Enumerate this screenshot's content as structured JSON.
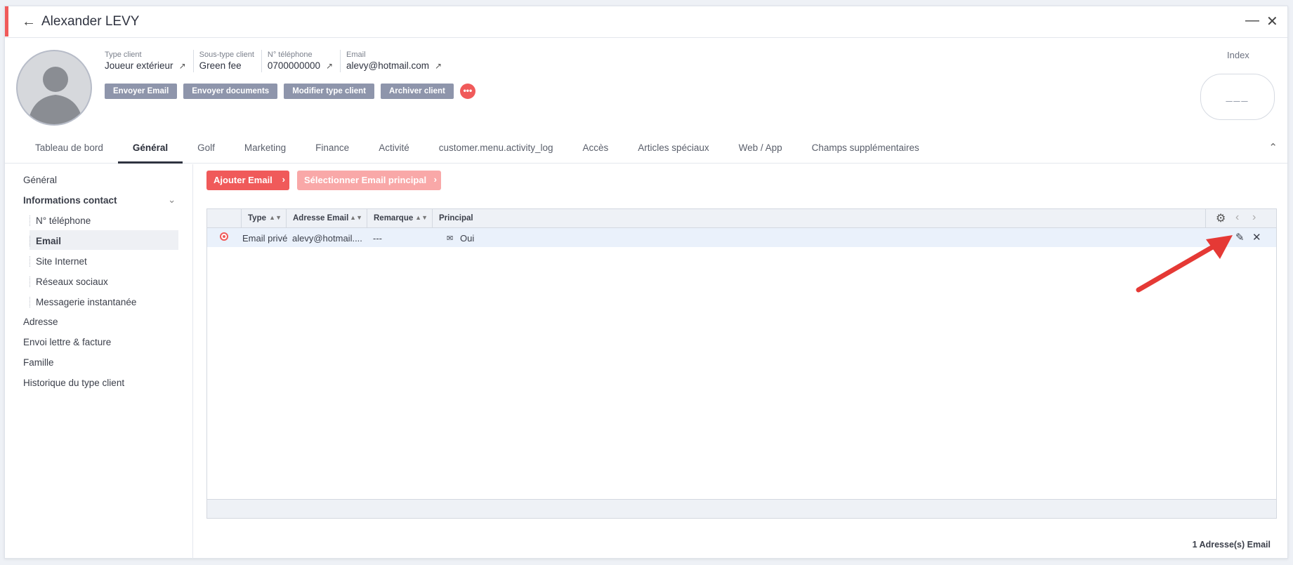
{
  "header": {
    "title": "Alexander LEVY"
  },
  "profile": {
    "fields": [
      {
        "label": "Type client",
        "value": "Joueur extérieur",
        "external": true
      },
      {
        "label": "Sous-type client",
        "value": "Green fee",
        "external": false
      },
      {
        "label": "N° téléphone",
        "value": "0700000000",
        "external": true
      },
      {
        "label": "Email",
        "value": "alevy@hotmail.com",
        "external": true
      }
    ],
    "actions": [
      "Envoyer Email",
      "Envoyer documents",
      "Modifier type client",
      "Archiver client"
    ],
    "more": "•••",
    "index_label": "Index",
    "index_value": "___"
  },
  "tabs": [
    "Tableau de bord",
    "Général",
    "Golf",
    "Marketing",
    "Finance",
    "Activité",
    "customer.menu.activity_log",
    "Accès",
    "Articles spéciaux",
    "Web / App",
    "Champs supplémentaires"
  ],
  "active_tab": "Général",
  "sidebar": {
    "items": [
      "Général",
      "Informations contact",
      "N° téléphone",
      "Email",
      "Site Internet",
      "Réseaux sociaux",
      "Messagerie instantanée",
      "Adresse",
      "Envoi lettre & facture",
      "Famille",
      "Historique du type client"
    ]
  },
  "toolbar": {
    "add": "Ajouter Email",
    "select_primary": "Sélectionner Email principal"
  },
  "grid": {
    "columns": [
      "Type",
      "Adresse Email",
      "Remarque",
      "Principal"
    ],
    "rows": [
      {
        "type": "Email privé",
        "email": "alevy@hotmail....",
        "remark": "---",
        "principal": "Oui"
      }
    ]
  },
  "footer": {
    "count": "1 Adresse(s) Email"
  },
  "colors": {
    "accent": "#f05a5a",
    "accent_light": "#f9a8a8",
    "button_gray": "#8e95ab",
    "row_selected": "#eaf1fb"
  }
}
